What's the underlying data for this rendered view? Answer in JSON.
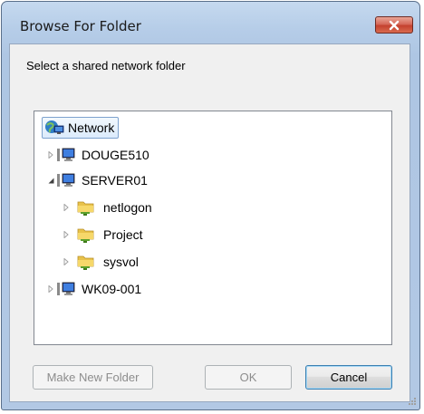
{
  "window": {
    "title": "Browse For Folder",
    "accent_close": "#c4412f"
  },
  "prompt": "Select a shared network folder",
  "tree": {
    "root": {
      "label": "Network",
      "icon": "network-icon",
      "selected": true
    },
    "computers": [
      {
        "label": "DOUGE510",
        "icon": "computer-icon",
        "expanded": false
      },
      {
        "label": "SERVER01",
        "icon": "computer-icon",
        "expanded": true,
        "children": [
          {
            "label": "netlogon",
            "icon": "shared-folder-icon"
          },
          {
            "label": "Project",
            "icon": "shared-folder-icon"
          },
          {
            "label": "sysvol",
            "icon": "shared-folder-icon"
          }
        ]
      },
      {
        "label": "WK09-001",
        "icon": "computer-icon",
        "expanded": false
      }
    ]
  },
  "buttons": {
    "make_new_folder": "Make New Folder",
    "ok": "OK",
    "cancel": "Cancel"
  }
}
